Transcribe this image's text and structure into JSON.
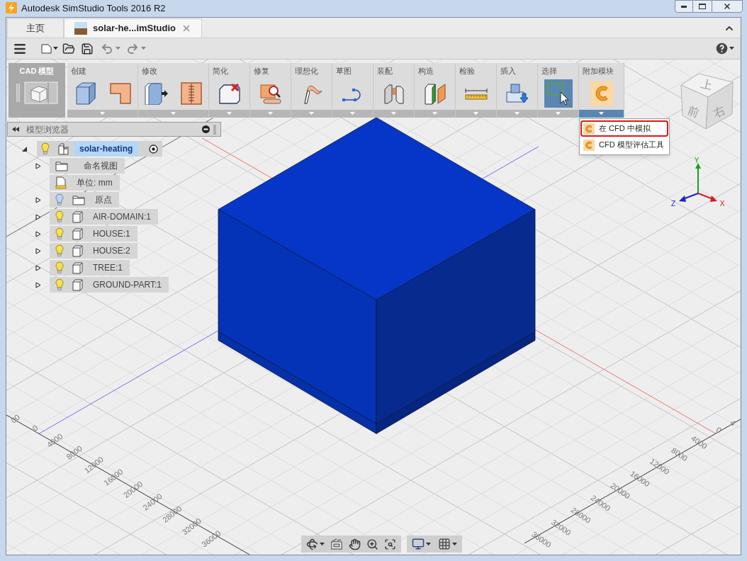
{
  "window": {
    "title": "Autodesk SimStudio Tools 2016 R2"
  },
  "tabs": [
    {
      "label": "主页",
      "selected": false,
      "closable": false
    },
    {
      "label": "solar-he...imStudio",
      "selected": true,
      "closable": true
    }
  ],
  "ribbon": {
    "workspace": "CAD 模型",
    "groups": [
      {
        "label": "创建",
        "selected": false,
        "expanded": false
      },
      {
        "label": "修改",
        "selected": false,
        "expanded": false
      },
      {
        "label": "简化",
        "selected": false,
        "expanded": false
      },
      {
        "label": "修复",
        "selected": false,
        "expanded": false
      },
      {
        "label": "理想化",
        "selected": false,
        "expanded": false
      },
      {
        "label": "草图",
        "selected": false,
        "expanded": false
      },
      {
        "label": "装配",
        "selected": false,
        "expanded": false
      },
      {
        "label": "构造",
        "selected": false,
        "expanded": false
      },
      {
        "label": "检验",
        "selected": false,
        "expanded": false
      },
      {
        "label": "插入",
        "selected": false,
        "expanded": false
      },
      {
        "label": "选择",
        "selected": true,
        "expanded": false
      },
      {
        "label": "附加模块",
        "selected": false,
        "expanded": true,
        "menu": [
          {
            "label": "在 CFD 中模拟",
            "selected": true
          },
          {
            "label": "CFD 模型评估工具",
            "selected": false
          }
        ]
      }
    ]
  },
  "browser": {
    "title": "模型浏览器",
    "root": {
      "label": "solar-heating",
      "expanded": true,
      "visible": true,
      "selected": true,
      "children": [
        {
          "kind": "folder",
          "label": "命名视图",
          "expanded": false,
          "selected": false
        },
        {
          "kind": "units",
          "label": "单位: mm",
          "selected": false
        },
        {
          "kind": "folder",
          "label": "原点",
          "expanded": false,
          "visible": false,
          "selected": false
        },
        {
          "kind": "component",
          "label": "AIR-DOMAIN:1",
          "expanded": false,
          "visible": true,
          "selected": false
        },
        {
          "kind": "component",
          "label": "HOUSE:1",
          "expanded": false,
          "visible": true,
          "selected": false
        },
        {
          "kind": "component",
          "label": "HOUSE:2",
          "expanded": false,
          "visible": true,
          "selected": false
        },
        {
          "kind": "component",
          "label": "TREE:1",
          "expanded": false,
          "visible": true,
          "selected": false
        },
        {
          "kind": "component",
          "label": "GROUND-PART:1",
          "expanded": false,
          "visible": true,
          "selected": false
        }
      ]
    }
  },
  "viewport": {
    "viewcube": {
      "top": "上",
      "front": "前",
      "right": "右"
    },
    "triad": {
      "y": "Y",
      "z": "Z",
      "x": "X"
    },
    "left_axis_labels": [
      "00",
      "0",
      "4000",
      "8000",
      "12000",
      "16000",
      "20000",
      "24000",
      "28000",
      "32000",
      "36000"
    ],
    "right_axis_labels": [
      "4",
      "0",
      "4000",
      "8000",
      "12000",
      "16000",
      "20000",
      "24000",
      "28000",
      "32000",
      "36000"
    ]
  }
}
